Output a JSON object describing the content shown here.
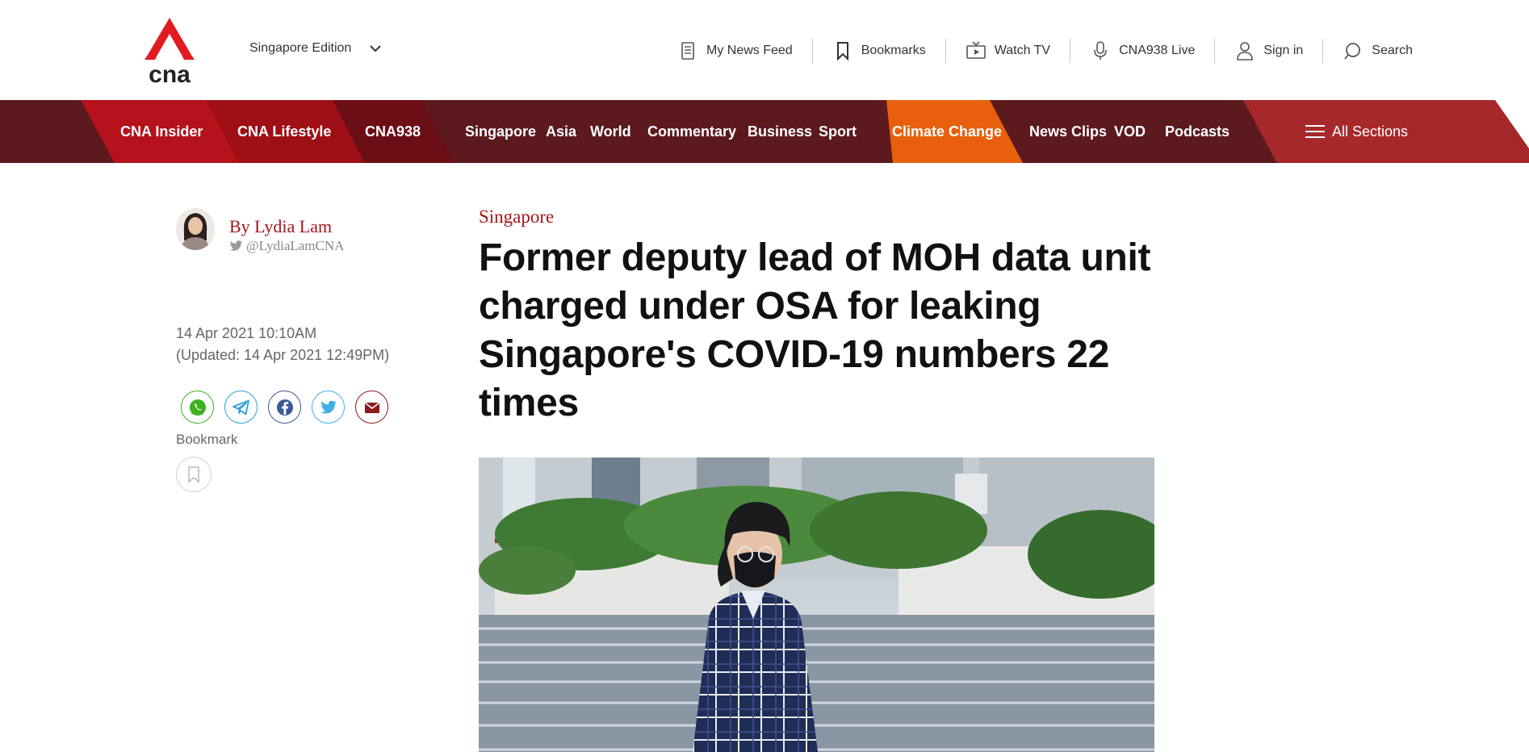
{
  "header": {
    "logo_text": "cna",
    "edition_label": "Singapore Edition",
    "utility": [
      {
        "label": "My News Feed",
        "icon": "news-feed-icon"
      },
      {
        "label": "Bookmarks",
        "icon": "bookmark-icon"
      },
      {
        "label": "Watch TV",
        "icon": "tv-icon"
      },
      {
        "label": "CNA938 Live",
        "icon": "microphone-icon"
      },
      {
        "label": "Sign in",
        "icon": "user-icon"
      },
      {
        "label": "Search",
        "icon": "search-icon"
      }
    ]
  },
  "nav": {
    "items": [
      {
        "label": "CNA Insider"
      },
      {
        "label": "CNA Lifestyle"
      },
      {
        "label": "CNA938"
      },
      {
        "label": "Singapore"
      },
      {
        "label": "Asia"
      },
      {
        "label": "World"
      },
      {
        "label": "Commentary"
      },
      {
        "label": "Business"
      },
      {
        "label": "Sport"
      },
      {
        "label": "Climate Change"
      },
      {
        "label": "News Clips"
      },
      {
        "label": "VOD"
      },
      {
        "label": "Podcasts"
      }
    ],
    "all_sections_label": "All Sections",
    "colors": {
      "dark": "#5c1a1f",
      "red": "#b5121b",
      "orange": "#e8600d",
      "mid_red": "#a7282b"
    }
  },
  "author": {
    "name": "By Lydia Lam",
    "handle": "@LydiaLamCNA"
  },
  "dates": {
    "published": "14 Apr 2021 10:10AM",
    "updated": "(Updated: 14 Apr 2021 12:49PM)"
  },
  "share": {
    "buttons": [
      {
        "name": "whatsapp",
        "color": "#3cb01f"
      },
      {
        "name": "telegram",
        "color": "#2aa0d8"
      },
      {
        "name": "facebook",
        "color": "#3b5998"
      },
      {
        "name": "twitter",
        "color": "#3fb0e6"
      },
      {
        "name": "email",
        "color": "#8b1a1a"
      }
    ],
    "bookmark_label": "Bookmark"
  },
  "article": {
    "category": "Singapore",
    "headline": "Former deputy lead of MOH data unit charged under OSA for leaking Singapore's COVID-19 numbers 22 times"
  }
}
